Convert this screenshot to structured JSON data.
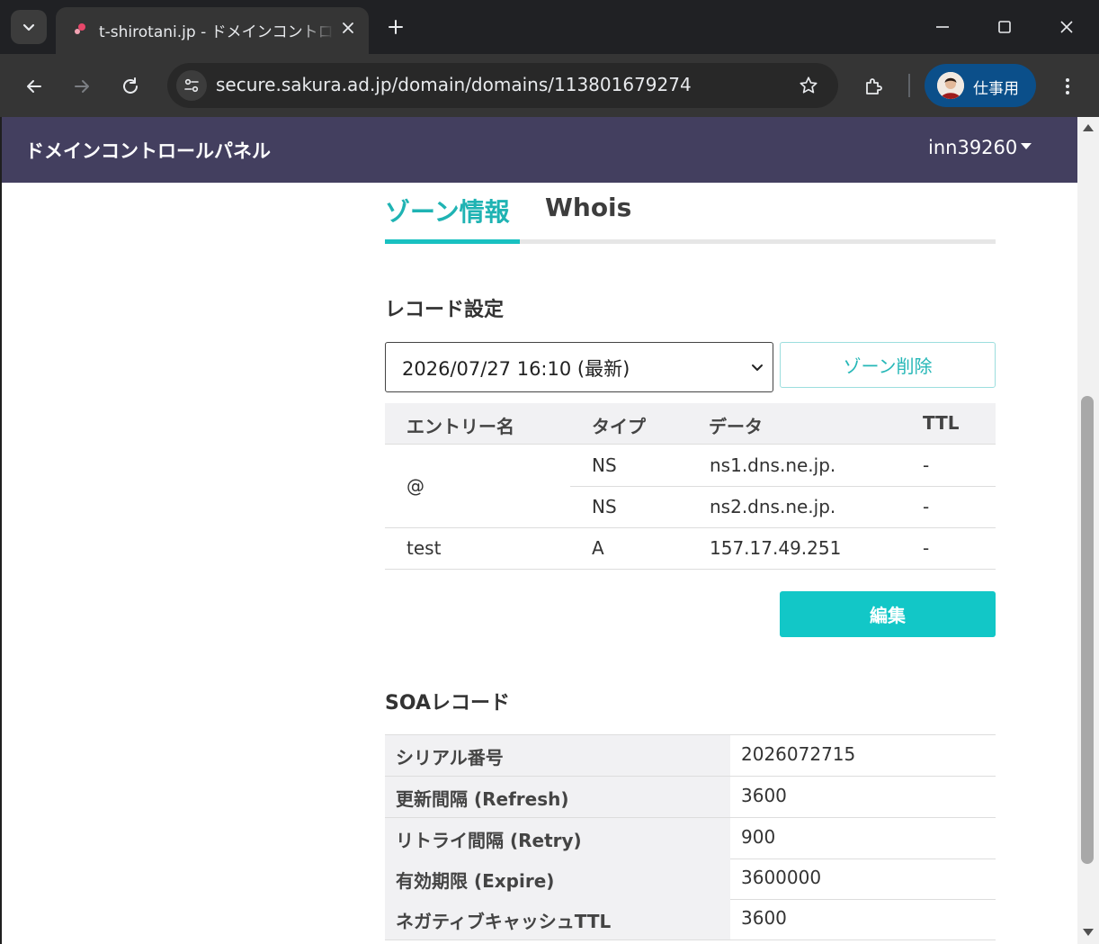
{
  "browser": {
    "tab_title": "t-shirotani.jp - ドメインコントロールパネル",
    "url": "secure.sakura.ad.jp/domain/domains/113801679274",
    "profile_label": "仕事用"
  },
  "header": {
    "app_title": "ドメインコントロールパネル",
    "user": "inn39260"
  },
  "tabs": {
    "zone": "ゾーン情報",
    "whois": "Whois"
  },
  "records": {
    "section_title": "レコード設定",
    "version_selected": "2026/07/27 16:10 (最新)",
    "delete_label": "ゾーン削除",
    "columns": [
      "エントリー名",
      "タイプ",
      "データ",
      "TTL"
    ],
    "rows": [
      {
        "entry": "@",
        "type": "NS",
        "data": "ns1.dns.ne.jp.",
        "ttl": "-"
      },
      {
        "entry": "",
        "type": "NS",
        "data": "ns2.dns.ne.jp.",
        "ttl": "-"
      },
      {
        "entry": "test",
        "type": "A",
        "data": "157.17.49.251",
        "ttl": "-"
      }
    ],
    "edit_label": "編集"
  },
  "soa": {
    "section_title": "SOAレコード",
    "rows": [
      {
        "label": "シリアル番号",
        "value": "2026072715"
      },
      {
        "label": "更新間隔 (Refresh)",
        "value": "3600"
      },
      {
        "label": "リトライ間隔 (Retry)",
        "value": "900"
      },
      {
        "label": "有効期限 (Expire)",
        "value": "3600000"
      },
      {
        "label": "ネガティブキャッシュTTL",
        "value": "3600"
      }
    ]
  },
  "colors": {
    "header_bg": "#433f5f",
    "accent": "#19c1c1",
    "profile_bg": "#0b4f8a"
  }
}
